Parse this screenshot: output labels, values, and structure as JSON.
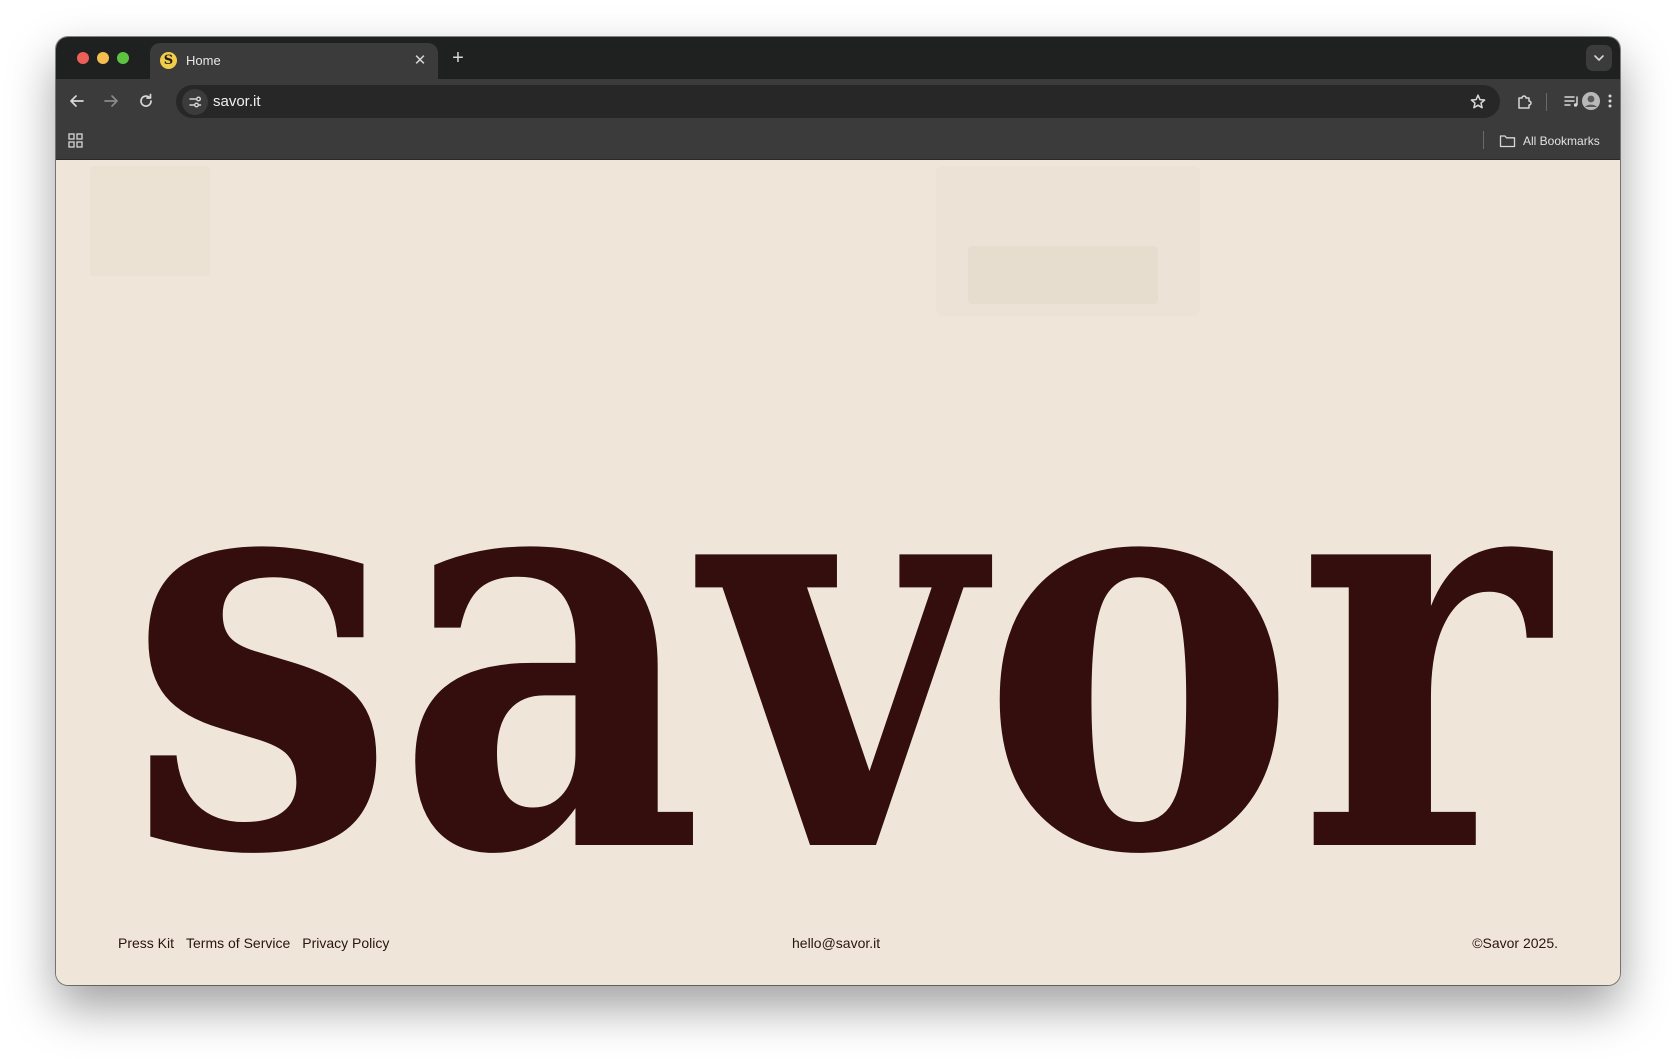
{
  "browser": {
    "tab": {
      "title": "Home",
      "favicon_letter": "S"
    },
    "address_bar": {
      "url": "savor.it"
    },
    "bookmarks_bar": {
      "all_bookmarks_label": "All Bookmarks"
    },
    "icons": {
      "back": "arrow-left-icon",
      "forward": "arrow-right-icon",
      "reload": "reload-icon",
      "site_info": "tune-icon",
      "bookmark_star": "star-icon",
      "extensions": "puzzle-icon",
      "media": "playlist-icon",
      "profile": "avatar",
      "menu": "kebab-menu-icon",
      "apps": "apps-grid-icon",
      "folder": "folder-icon"
    },
    "colors": {
      "tab_strip": "#1f2120",
      "toolbar": "#3a3b3a",
      "omnibox": "#262726"
    }
  },
  "page": {
    "wordmark": "savor",
    "footer": {
      "links": [
        "Press Kit",
        "Terms of Service",
        "Privacy Policy"
      ],
      "email": "hello@savor.it",
      "copyright": "©Savor 2025."
    },
    "colors": {
      "background": "#efe6d9",
      "wordmark": "#330e0c",
      "text": "#2a1310"
    }
  }
}
